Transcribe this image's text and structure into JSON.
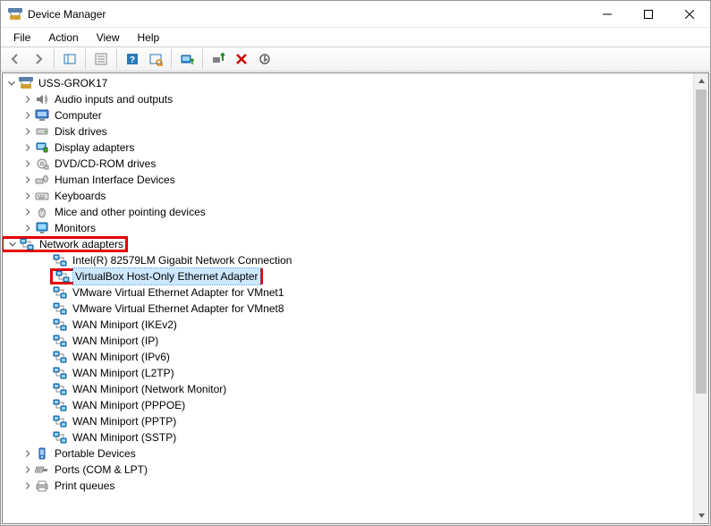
{
  "window": {
    "title": "Device Manager"
  },
  "menu": {
    "file": "File",
    "action": "Action",
    "view": "View",
    "help": "Help"
  },
  "tree": {
    "root": "USS-GROK17",
    "audio": "Audio inputs and outputs",
    "computer": "Computer",
    "disks": "Disk drives",
    "display": "Display adapters",
    "dvd": "DVD/CD-ROM drives",
    "hid": "Human Interface Devices",
    "keyboards": "Keyboards",
    "mice": "Mice and other pointing devices",
    "monitors": "Monitors",
    "network": "Network adapters",
    "net_items": {
      "intel": "Intel(R) 82579LM Gigabit Network Connection",
      "vbox": "VirtualBox Host-Only Ethernet Adapter",
      "vm1": "VMware Virtual Ethernet Adapter for VMnet1",
      "vm8": "VMware Virtual Ethernet Adapter for VMnet8",
      "wan_ikev2": "WAN Miniport (IKEv2)",
      "wan_ip": "WAN Miniport (IP)",
      "wan_ipv6": "WAN Miniport (IPv6)",
      "wan_l2tp": "WAN Miniport (L2TP)",
      "wan_netmon": "WAN Miniport (Network Monitor)",
      "wan_pppoe": "WAN Miniport (PPPOE)",
      "wan_pptp": "WAN Miniport (PPTP)",
      "wan_sstp": "WAN Miniport (SSTP)"
    },
    "portable": "Portable Devices",
    "ports": "Ports (COM & LPT)",
    "print": "Print queues"
  }
}
